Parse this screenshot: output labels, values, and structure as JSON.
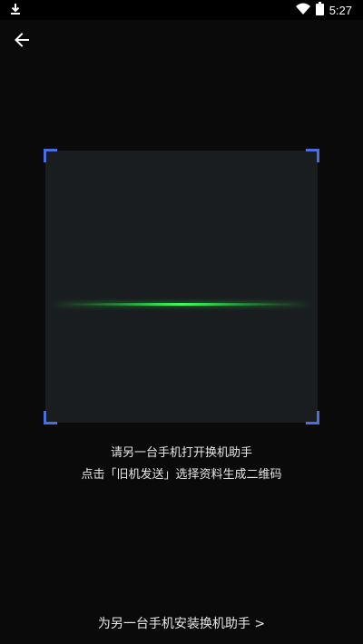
{
  "status_bar": {
    "time": "5:27",
    "icons": [
      "download-icon",
      "wifi-icon",
      "battery-icon"
    ]
  },
  "header": {
    "back_icon": "arrow-left-icon"
  },
  "scanner": {
    "accent_color": "#4a6ee0",
    "scan_line_color": "#3bff5a"
  },
  "instructions": {
    "line1": "请另一台手机打开换机助手",
    "line2": "点击「旧机发送」选择资料生成二维码"
  },
  "footer": {
    "install_link": "为另一台手机安装换机助手 >"
  }
}
